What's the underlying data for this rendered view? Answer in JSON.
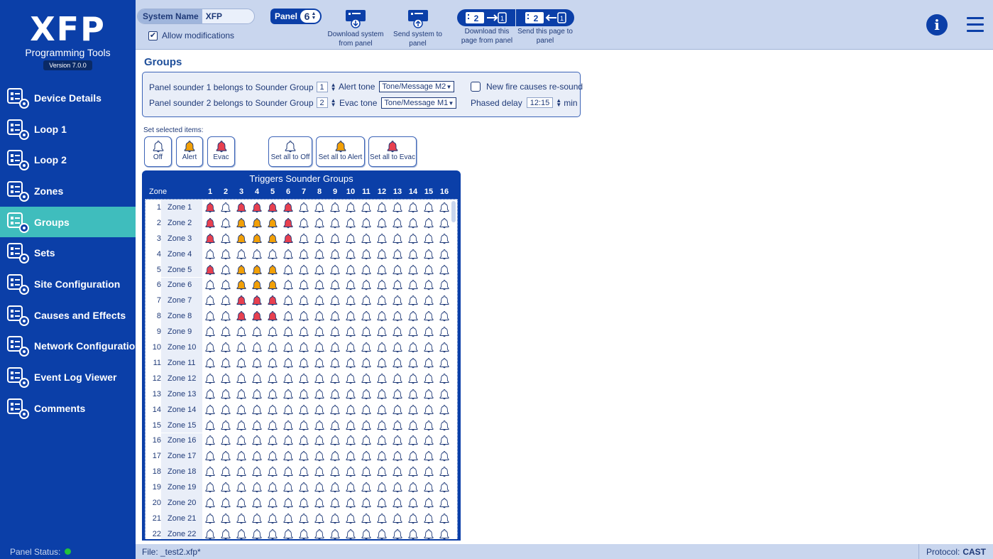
{
  "app": {
    "logo": "XFP",
    "subtitle": "Programming Tools",
    "version": "Version 7.0.0"
  },
  "sidebar": {
    "items": [
      {
        "label": "Device Details",
        "icon": "device-details-icon",
        "active": false
      },
      {
        "label": "Loop 1",
        "icon": "loop-icon",
        "active": false
      },
      {
        "label": "Loop 2",
        "icon": "loop-icon",
        "active": false
      },
      {
        "label": "Zones",
        "icon": "zones-icon",
        "active": false
      },
      {
        "label": "Groups",
        "icon": "groups-icon",
        "active": true
      },
      {
        "label": "Sets",
        "icon": "sets-icon",
        "active": false
      },
      {
        "label": "Site Configuration",
        "icon": "site-configuration-icon",
        "active": false
      },
      {
        "label": "Causes and Effects",
        "icon": "causes-effects-icon",
        "active": false
      },
      {
        "label": "Network Configuration",
        "icon": "network-configuration-icon",
        "active": false
      },
      {
        "label": "Event Log Viewer",
        "icon": "event-log-icon",
        "active": false
      },
      {
        "label": "Comments",
        "icon": "comments-icon",
        "active": false
      }
    ]
  },
  "toolbar": {
    "system_name_label": "System Name",
    "system_name_value": "XFP",
    "allow_modifications": "Allow modifications",
    "allow_checked": true,
    "panel_label": "Panel",
    "panel_value": "6",
    "download_system": "Download system from panel",
    "send_system": "Send system to panel",
    "download_page": "Download this page from panel",
    "send_page": "Send this page to panel",
    "page_badge": "2"
  },
  "groups": {
    "title": "Groups",
    "sounder1_label": "Panel sounder 1 belongs to Sounder Group",
    "sounder1_value": "1",
    "sounder2_label": "Panel sounder 2 belongs to Sounder Group",
    "sounder2_value": "2",
    "alert_tone_label": "Alert tone",
    "alert_tone_value": "Tone/Message M2",
    "evac_tone_label": "Evac tone",
    "evac_tone_value": "Tone/Message M1",
    "new_fire_label": "New fire causes re-sound",
    "new_fire_checked": false,
    "phased_delay_label": "Phased delay",
    "phased_delay_value": "12:15",
    "phased_delay_unit": "min"
  },
  "set_selected": {
    "label": "Set selected items:",
    "off": "Off",
    "alert": "Alert",
    "evac": "Evac",
    "all_off": "Set all to Off",
    "all_alert": "Set all to Alert",
    "all_evac": "Set all to Evac"
  },
  "colors": {
    "off": "#ffffff",
    "alert": "#f2a007",
    "evac": "#e8404f",
    "outline": "#1f3a78"
  },
  "matrix": {
    "title": "Triggers Sounder Groups",
    "zone_header": "Zone",
    "columns": [
      "1",
      "2",
      "3",
      "4",
      "5",
      "6",
      "7",
      "8",
      "9",
      "10",
      "11",
      "12",
      "13",
      "14",
      "15",
      "16"
    ],
    "rows": [
      {
        "num": "1",
        "name": "Zone 1",
        "states": "E0EEEE0000000000"
      },
      {
        "num": "2",
        "name": "Zone 2",
        "states": "E0AAAE0000000000"
      },
      {
        "num": "3",
        "name": "Zone 3",
        "states": "E0AAAE0000000000"
      },
      {
        "num": "4",
        "name": "Zone 4",
        "states": "0000000000000000"
      },
      {
        "num": "5",
        "name": "Zone 5",
        "states": "E0AAA00000000000"
      },
      {
        "num": "6",
        "name": "Zone 6",
        "states": "00AAA00000000000"
      },
      {
        "num": "7",
        "name": "Zone 7",
        "states": "00EEE00000000000"
      },
      {
        "num": "8",
        "name": "Zone 8",
        "states": "00EEE00000000000"
      },
      {
        "num": "9",
        "name": "Zone 9",
        "states": "0000000000000000"
      },
      {
        "num": "10",
        "name": "Zone 10",
        "states": "0000000000000000"
      },
      {
        "num": "11",
        "name": "Zone 11",
        "states": "0000000000000000"
      },
      {
        "num": "12",
        "name": "Zone 12",
        "states": "0000000000000000"
      },
      {
        "num": "13",
        "name": "Zone 13",
        "states": "0000000000000000"
      },
      {
        "num": "14",
        "name": "Zone 14",
        "states": "0000000000000000"
      },
      {
        "num": "15",
        "name": "Zone 15",
        "states": "0000000000000000"
      },
      {
        "num": "16",
        "name": "Zone 16",
        "states": "0000000000000000"
      },
      {
        "num": "17",
        "name": "Zone 17",
        "states": "0000000000000000"
      },
      {
        "num": "18",
        "name": "Zone 18",
        "states": "0000000000000000"
      },
      {
        "num": "19",
        "name": "Zone 19",
        "states": "0000000000000000"
      },
      {
        "num": "20",
        "name": "Zone 20",
        "states": "0000000000000000"
      },
      {
        "num": "21",
        "name": "Zone 21",
        "states": "0000000000000000"
      },
      {
        "num": "22",
        "name": "Zone 22",
        "states": "0000000000000000"
      }
    ]
  },
  "status": {
    "panel_status": "Panel Status:",
    "file": "File: _test2.xfp*",
    "protocol_label": "Protocol:",
    "protocol_value": "CAST"
  }
}
